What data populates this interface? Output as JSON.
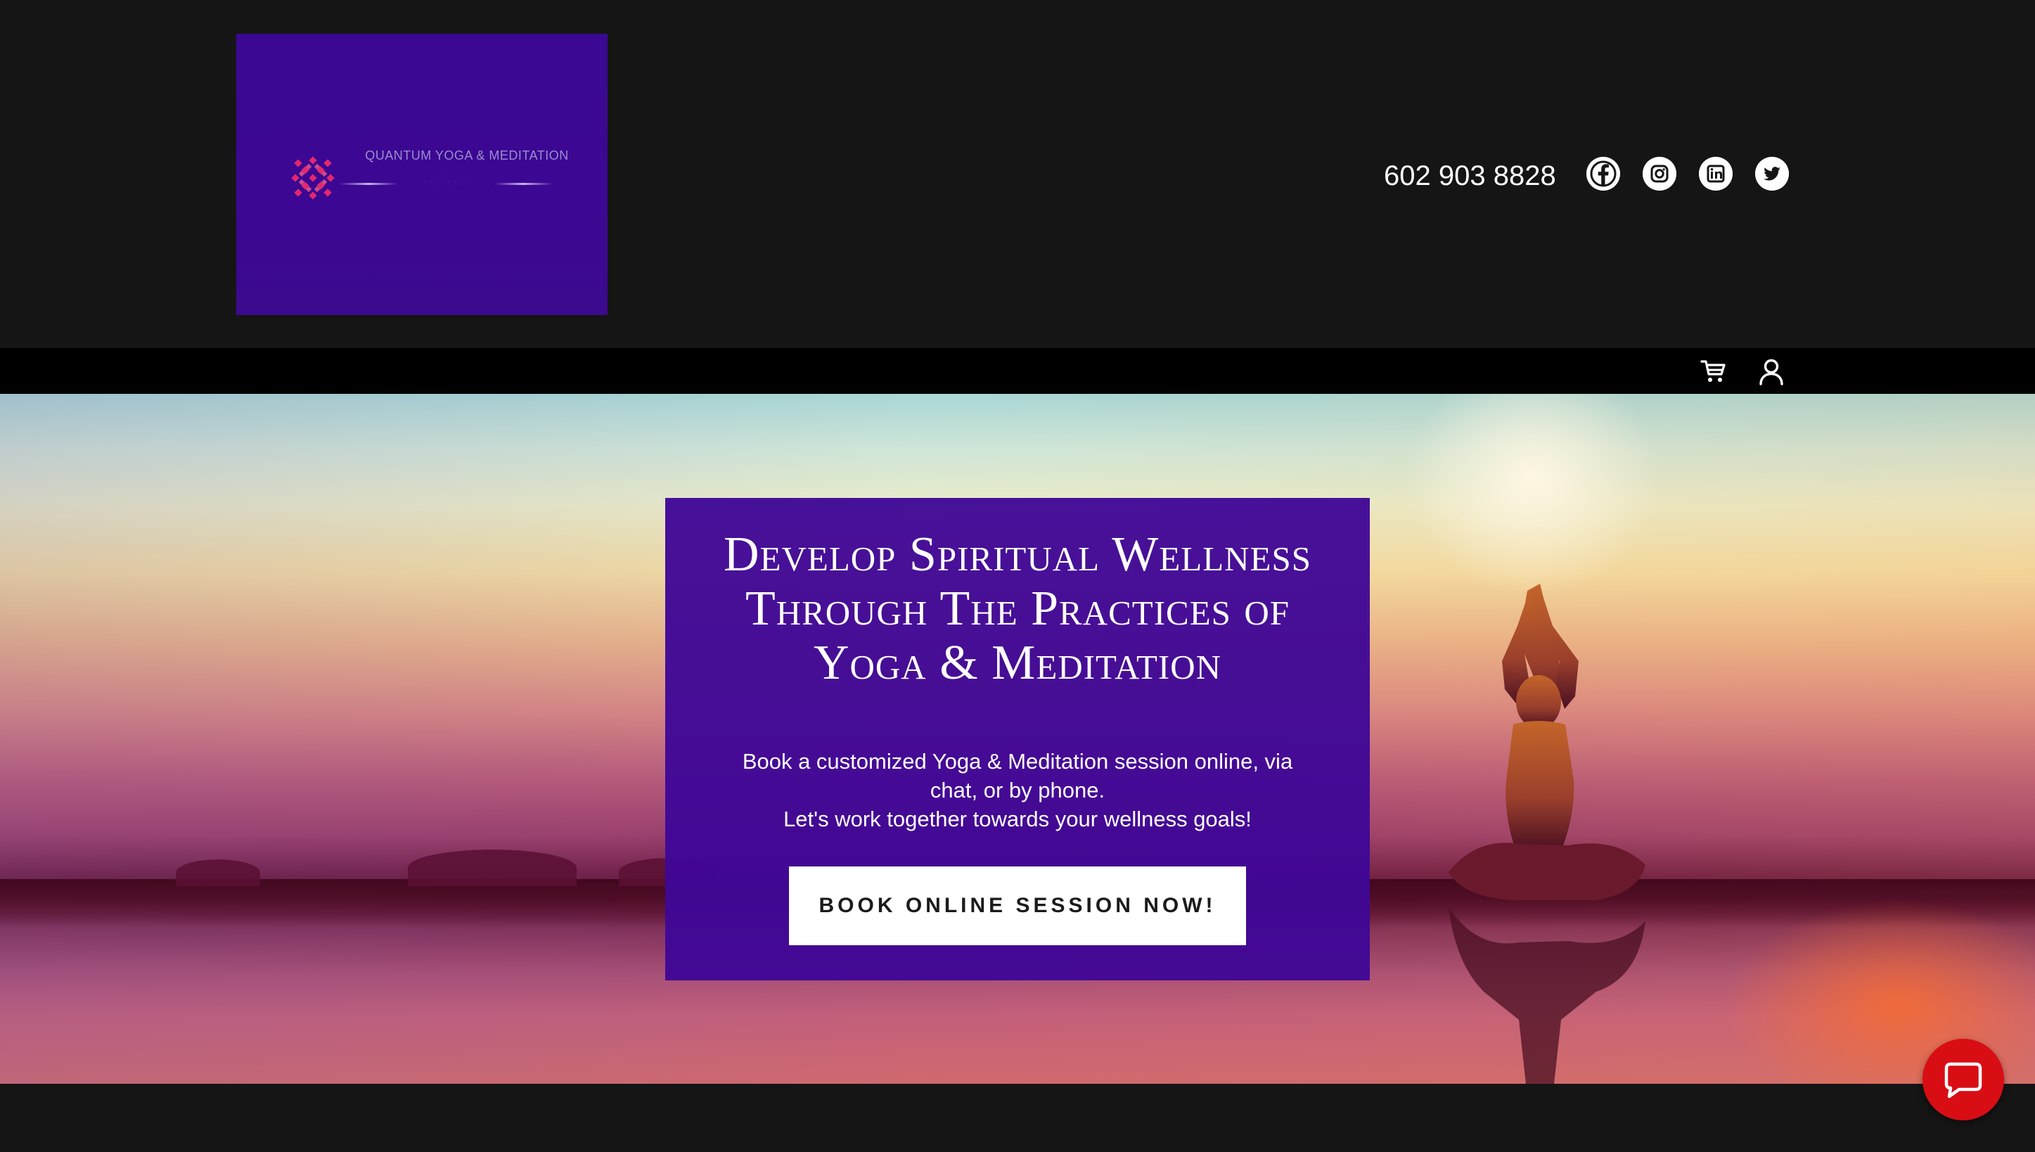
{
  "header": {
    "logo_text": "QUANTUM YOGA & MEDITATION",
    "phone": "602 903 8828",
    "social": [
      {
        "name": "facebook",
        "icon": "facebook-icon"
      },
      {
        "name": "instagram",
        "icon": "instagram-icon"
      },
      {
        "name": "linkedin",
        "icon": "linkedin-icon"
      },
      {
        "name": "twitter",
        "icon": "twitter-icon"
      }
    ]
  },
  "nav": {
    "icons": [
      "cart-icon",
      "account-icon"
    ]
  },
  "hero": {
    "title": "Develop Spiritual Wellness Through The Practices of Yoga & Meditation",
    "line1": "Book a customized Yoga & Meditation session online, via chat, or by phone.",
    "line2": "Let's work together towards your wellness goals!",
    "cta_label": "BOOK ONLINE SESSION NOW!"
  },
  "chat": {
    "icon": "chat-bubble-icon"
  },
  "colors": {
    "header_bg": "#151515",
    "nav_bg": "#000000",
    "card_bg": "#3f0796",
    "logo_bg": "#3a0892",
    "chat_button": "#d90d14",
    "cta_bg": "#ffffff",
    "cta_text": "#1b1b1b"
  }
}
